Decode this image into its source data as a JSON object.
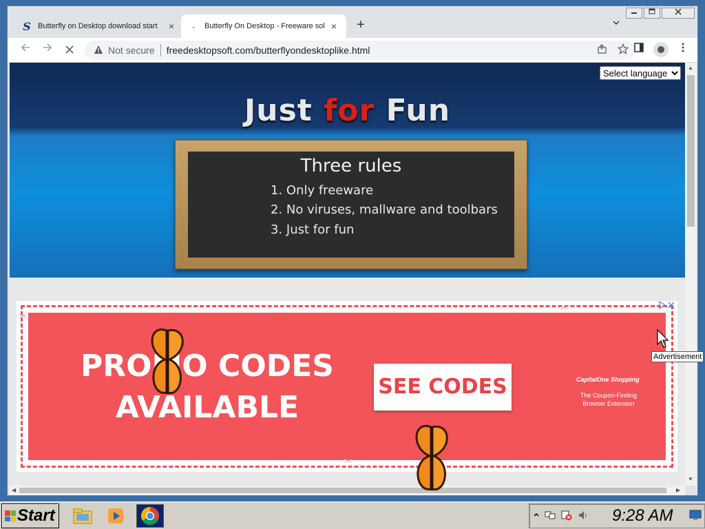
{
  "browser": {
    "tabs": [
      {
        "title": "Butterfly on Desktop download start",
        "favicon": "softpedia-s-icon",
        "close": "×",
        "active": false
      },
      {
        "title": "Butterfly On Desktop - Freeware sol",
        "favicon": "loading-icon",
        "close": "×",
        "active": true
      }
    ],
    "new_tab": "+",
    "tab_menu": "⌄",
    "window_controls": {
      "minimize": "—",
      "maximize": "▭",
      "close": "✕"
    },
    "security_label": "Not secure",
    "url": "freedesktopsoft.com/butterflyondesktoplike.html"
  },
  "page": {
    "language_select": {
      "selected": "Select language"
    },
    "header": {
      "word1": "Just",
      "word2": "for",
      "word3": "Fun"
    },
    "chalkboard": {
      "title": "Three rules",
      "rules": [
        "1. Only freeware",
        "2. No viruses, mallware and toolbars",
        "3. Just for fun"
      ]
    },
    "ad": {
      "line1": "PROMO CODES",
      "line2": "AVAILABLE",
      "button": "SEE CODES",
      "brand": "CapitalOne Shopping",
      "tagline1": "The Coupon-Finding",
      "tagline2": "Browser Extension",
      "tooltip": "Advertisement"
    }
  },
  "taskbar": {
    "start_label": "Start",
    "clock": "9:28 AM",
    "quick_launch": [
      "explorer-icon",
      "media-player-icon",
      "chrome-icon"
    ]
  },
  "colors": {
    "ad_red": "#f25459",
    "header_dark": "#0f2a55",
    "header_blue": "#0e8fdd"
  }
}
